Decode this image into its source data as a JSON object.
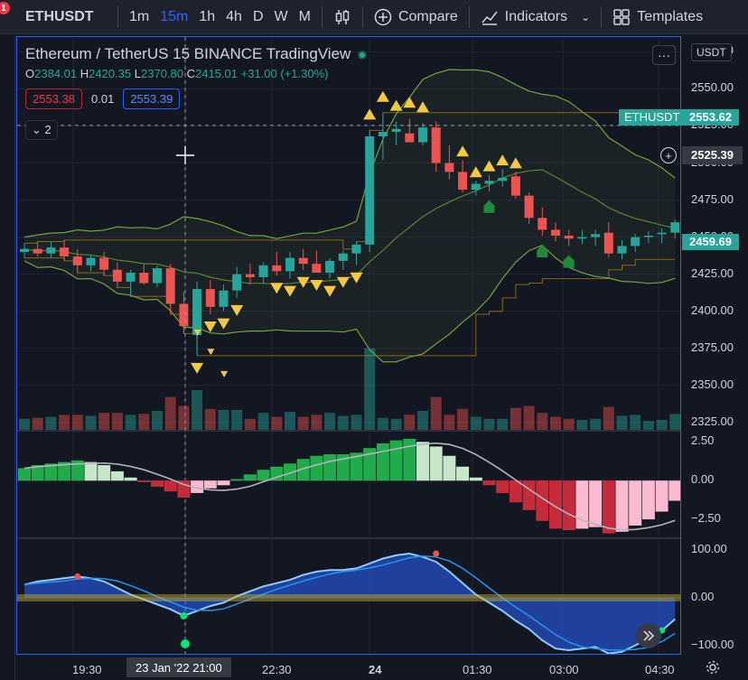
{
  "toolbar": {
    "symbol": "ETHUSDT",
    "alert_badge": "1",
    "intervals": [
      "1m",
      "15m",
      "1h",
      "4h",
      "D",
      "W",
      "M"
    ],
    "active_interval": "15m",
    "compare_label": "Compare",
    "indicators_label": "Indicators",
    "templates_label": "Templates"
  },
  "legend": {
    "title": "Ethereum / TetherUS  15  BINANCE  TradingView",
    "ohlc": {
      "o": "2384.01",
      "h": "2420.35",
      "l": "2370.80",
      "c": "2415.01",
      "change": "+31.00 (+1.30%)"
    },
    "sell": "2553.38",
    "spread": "0.01",
    "buy": "2553.39",
    "collapse": "2"
  },
  "price_axis": {
    "currency": "USDT",
    "ticks": [
      "2575.00",
      "2550.00",
      "2525.00",
      "2500.00",
      "2475.00",
      "2450.00",
      "2425.00",
      "2400.00",
      "2375.00",
      "2350.00",
      "2325.00"
    ],
    "tag_symbol": "ETHUSDT",
    "tag_price": "2553.62",
    "crosshair_price": "2525.39",
    "last_price": "2459.69",
    "osc_ticks": [
      "2.50",
      "0.00",
      "−2.50"
    ],
    "wt_ticks": [
      "100.00",
      "0.00",
      "−100.00"
    ]
  },
  "time_axis": {
    "ticks": [
      "19:30",
      "21:00",
      "22:30",
      "24",
      "01:30",
      "03:00",
      "04:30"
    ],
    "crosshair_time": "23 Jan '22  21:00"
  },
  "colors": {
    "up": "#26a69a",
    "down": "#ef5350",
    "accent": "#2962ff",
    "signal": "#f5c842",
    "bg": "#131722"
  },
  "icons": {
    "chart_type": "candles-icon",
    "compare": "plus-circle-icon",
    "indicators": "indicators-icon",
    "templates": "grid-icon",
    "more": "more-icon",
    "settings": "gear-icon",
    "scroll": "chevrons-right-icon"
  },
  "chart_data": {
    "type": "candlestick",
    "ylim": [
      2320,
      2585
    ],
    "candles": [
      {
        "o": 2440,
        "h": 2446,
        "l": 2436,
        "c": 2442
      },
      {
        "o": 2442,
        "h": 2447,
        "l": 2437,
        "c": 2439
      },
      {
        "o": 2439,
        "h": 2447,
        "l": 2436,
        "c": 2443
      },
      {
        "o": 2443,
        "h": 2448,
        "l": 2434,
        "c": 2437
      },
      {
        "o": 2437,
        "h": 2442,
        "l": 2426,
        "c": 2431
      },
      {
        "o": 2431,
        "h": 2438,
        "l": 2427,
        "c": 2436
      },
      {
        "o": 2436,
        "h": 2440,
        "l": 2424,
        "c": 2428
      },
      {
        "o": 2428,
        "h": 2433,
        "l": 2416,
        "c": 2420
      },
      {
        "o": 2420,
        "h": 2428,
        "l": 2410,
        "c": 2426
      },
      {
        "o": 2426,
        "h": 2432,
        "l": 2418,
        "c": 2419
      },
      {
        "o": 2419,
        "h": 2431,
        "l": 2416,
        "c": 2429
      },
      {
        "o": 2429,
        "h": 2432,
        "l": 2398,
        "c": 2405
      },
      {
        "o": 2405,
        "h": 2413,
        "l": 2385,
        "c": 2390
      },
      {
        "o": 2384,
        "h": 2420,
        "l": 2370,
        "c": 2415
      },
      {
        "o": 2415,
        "h": 2421,
        "l": 2398,
        "c": 2403
      },
      {
        "o": 2403,
        "h": 2418,
        "l": 2400,
        "c": 2414
      },
      {
        "o": 2414,
        "h": 2430,
        "l": 2409,
        "c": 2425
      },
      {
        "o": 2425,
        "h": 2432,
        "l": 2418,
        "c": 2423
      },
      {
        "o": 2423,
        "h": 2433,
        "l": 2419,
        "c": 2431
      },
      {
        "o": 2431,
        "h": 2440,
        "l": 2424,
        "c": 2427
      },
      {
        "o": 2427,
        "h": 2440,
        "l": 2422,
        "c": 2436
      },
      {
        "o": 2436,
        "h": 2442,
        "l": 2428,
        "c": 2432
      },
      {
        "o": 2432,
        "h": 2441,
        "l": 2426,
        "c": 2426
      },
      {
        "o": 2426,
        "h": 2436,
        "l": 2422,
        "c": 2434
      },
      {
        "o": 2434,
        "h": 2441,
        "l": 2428,
        "c": 2439
      },
      {
        "o": 2439,
        "h": 2447,
        "l": 2431,
        "c": 2445
      },
      {
        "o": 2445,
        "h": 2522,
        "l": 2440,
        "c": 2518
      },
      {
        "o": 2518,
        "h": 2534,
        "l": 2502,
        "c": 2521
      },
      {
        "o": 2521,
        "h": 2528,
        "l": 2512,
        "c": 2523
      },
      {
        "o": 2520,
        "h": 2530,
        "l": 2514,
        "c": 2514
      },
      {
        "o": 2514,
        "h": 2527,
        "l": 2512,
        "c": 2524
      },
      {
        "o": 2524,
        "h": 2528,
        "l": 2494,
        "c": 2500
      },
      {
        "o": 2500,
        "h": 2512,
        "l": 2489,
        "c": 2494
      },
      {
        "o": 2494,
        "h": 2502,
        "l": 2480,
        "c": 2482
      },
      {
        "o": 2482,
        "h": 2488,
        "l": 2478,
        "c": 2486
      },
      {
        "o": 2486,
        "h": 2492,
        "l": 2481,
        "c": 2488
      },
      {
        "o": 2488,
        "h": 2496,
        "l": 2484,
        "c": 2490
      },
      {
        "o": 2491,
        "h": 2494,
        "l": 2476,
        "c": 2478
      },
      {
        "o": 2478,
        "h": 2480,
        "l": 2459,
        "c": 2463
      },
      {
        "o": 2463,
        "h": 2470,
        "l": 2451,
        "c": 2455
      },
      {
        "o": 2455,
        "h": 2460,
        "l": 2447,
        "c": 2451
      },
      {
        "o": 2451,
        "h": 2455,
        "l": 2444,
        "c": 2449
      },
      {
        "o": 2449,
        "h": 2455,
        "l": 2445,
        "c": 2450
      },
      {
        "o": 2450,
        "h": 2455,
        "l": 2444,
        "c": 2452
      },
      {
        "o": 2453,
        "h": 2460,
        "l": 2436,
        "c": 2439
      },
      {
        "o": 2439,
        "h": 2448,
        "l": 2435,
        "c": 2444
      },
      {
        "o": 2444,
        "h": 2452,
        "l": 2440,
        "c": 2450
      },
      {
        "o": 2451,
        "h": 2454,
        "l": 2446,
        "c": 2451
      },
      {
        "o": 2452,
        "h": 2456,
        "l": 2446,
        "c": 2453
      },
      {
        "o": 2453,
        "h": 2462,
        "l": 2449,
        "c": 2460
      }
    ],
    "histogram": [
      0.8,
      1.0,
      1.1,
      1.2,
      1.3,
      1.2,
      1.0,
      0.6,
      0.2,
      -0.1,
      -0.4,
      -0.7,
      -1.1,
      -0.8,
      -0.5,
      -0.3,
      0.1,
      0.4,
      0.7,
      0.9,
      1.1,
      1.4,
      1.6,
      1.7,
      1.7,
      1.8,
      2.1,
      2.4,
      2.6,
      2.7,
      2.5,
      2.2,
      1.6,
      0.9,
      0.2,
      -0.3,
      -0.8,
      -1.4,
      -1.9,
      -2.6,
      -3.1,
      -3.2,
      -3.1,
      -3.0,
      -3.4,
      -3.3,
      -2.9,
      -2.5,
      -2.0,
      -1.3
    ],
    "osc_ylim": [
      -3.6,
      3.1
    ],
    "wt_ylim": [
      -120,
      120
    ]
  }
}
